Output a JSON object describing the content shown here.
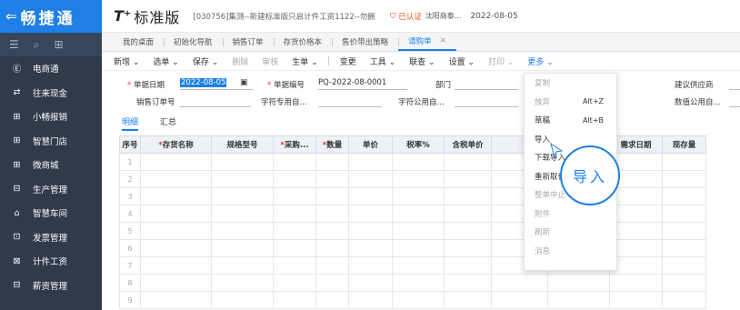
{
  "sidebar": {
    "brand": "畅捷通",
    "items": [
      {
        "label": "电商通",
        "icon": "e-commerce-icon"
      },
      {
        "label": "往来现金",
        "icon": "exchange-icon"
      },
      {
        "label": "小畅报销",
        "icon": "reimburse-icon"
      },
      {
        "label": "智慧门店",
        "icon": "store-icon"
      },
      {
        "label": "微商城",
        "icon": "mall-icon"
      },
      {
        "label": "生产管理",
        "icon": "production-icon"
      },
      {
        "label": "智慧车间",
        "icon": "workshop-icon"
      },
      {
        "label": "发票管理",
        "icon": "invoice-icon"
      },
      {
        "label": "计件工资",
        "icon": "piecework-icon"
      },
      {
        "label": "薪资管理",
        "icon": "salary-icon"
      }
    ]
  },
  "header": {
    "logo": "T⁺",
    "version": "标准版",
    "org": "[030756]集测--新建标准版只启计件工资1122--勿删",
    "verified": "已认证",
    "company": "沈阳商泰...",
    "date": "2022-08-05"
  },
  "tabs": [
    {
      "label": "我的桌面"
    },
    {
      "label": "初始化导航"
    },
    {
      "label": "销售订单"
    },
    {
      "label": "存货价格本"
    },
    {
      "label": "售价带出策略"
    },
    {
      "label": "请购单"
    }
  ],
  "toolbar": {
    "items": [
      "新增",
      "选单",
      "保存",
      "删除",
      "审核",
      "生单",
      "变更",
      "工具",
      "联查",
      "设置",
      "打印",
      "更多"
    ]
  },
  "form": {
    "doc_date_label": "单据日期",
    "doc_date_value": "2022-08-05",
    "doc_no_label": "单据编号",
    "doc_no_value": "PQ-2022-08-0001",
    "dept_label": "部门",
    "supplier_label": "建议供应商",
    "sales_order_label": "销售订单号",
    "char_custom_label": "字符专用自...",
    "char_public_label": "字符公用自...",
    "num_public_label": "数值公用自..."
  },
  "subtabs": [
    "明细",
    "汇总"
  ],
  "grid": {
    "columns": [
      {
        "label": "序号",
        "required": false
      },
      {
        "label": "存货名称",
        "required": true
      },
      {
        "label": "规格型号",
        "required": false
      },
      {
        "label": "采购...",
        "required": true
      },
      {
        "label": "数量",
        "required": true
      },
      {
        "label": "单价",
        "required": false
      },
      {
        "label": "税率%",
        "required": false
      },
      {
        "label": "含税单价",
        "required": false
      },
      {
        "label": "",
        "required": false
      },
      {
        "label": "",
        "required": false
      },
      {
        "label": "需求日期",
        "required": false
      },
      {
        "label": "现存量",
        "required": false
      }
    ],
    "rows": [
      "1",
      "2",
      "3",
      "4",
      "5",
      "6",
      "7",
      "8",
      "9"
    ]
  },
  "menu": {
    "items": [
      {
        "label": "复制",
        "shortcut": "",
        "disabled": true
      },
      {
        "label": "放弃",
        "shortcut": "Alt+Z",
        "disabled": true
      },
      {
        "label": "草稿",
        "shortcut": "Alt+B",
        "disabled": false
      },
      {
        "label": "导入",
        "shortcut": "",
        "disabled": false
      },
      {
        "label": "下载导入...",
        "shortcut": "",
        "disabled": false
      },
      {
        "label": "重新取价",
        "shortcut": "",
        "disabled": false
      },
      {
        "label": "整单中止",
        "shortcut": "",
        "disabled": true
      },
      {
        "label": "附件",
        "shortcut": "",
        "disabled": true
      },
      {
        "label": "刷新",
        "shortcut": "",
        "disabled": true
      },
      {
        "label": "消息",
        "shortcut": "",
        "disabled": true
      }
    ]
  },
  "callout": "导入",
  "colors": {
    "brand_blue": "#1e80e6",
    "sidebar_bg": "#2f3a4b",
    "verify_orange": "#e8531f",
    "required_red": "#e53935"
  }
}
